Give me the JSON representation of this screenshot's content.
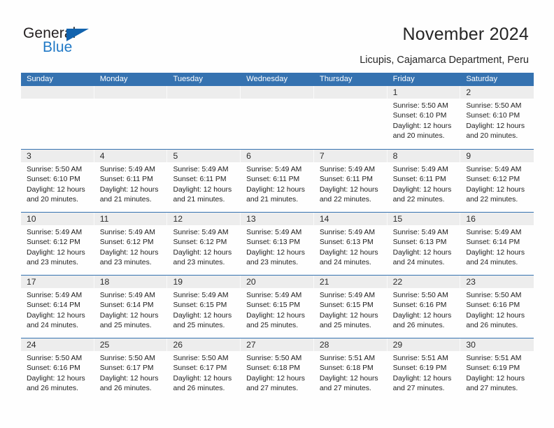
{
  "brand": {
    "name_part1": "General",
    "name_part2": "Blue",
    "triangle_color": "#1263ae",
    "blue_text_color": "#2079c6",
    "dark_text_color": "#231f20"
  },
  "header": {
    "title": "November 2024",
    "subtitle": "Licupis, Cajamarca Department, Peru",
    "accent_color": "#3572b0"
  },
  "calendar": {
    "weekdays": [
      "Sunday",
      "Monday",
      "Tuesday",
      "Wednesday",
      "Thursday",
      "Friday",
      "Saturday"
    ],
    "labels": {
      "sunrise": "Sunrise:",
      "sunset": "Sunset:",
      "daylight": "Daylight:"
    },
    "weeks": [
      [
        {
          "day": "",
          "sunrise": "",
          "sunset": "",
          "daylight_l1": "",
          "daylight_l2": ""
        },
        {
          "day": "",
          "sunrise": "",
          "sunset": "",
          "daylight_l1": "",
          "daylight_l2": ""
        },
        {
          "day": "",
          "sunrise": "",
          "sunset": "",
          "daylight_l1": "",
          "daylight_l2": ""
        },
        {
          "day": "",
          "sunrise": "",
          "sunset": "",
          "daylight_l1": "",
          "daylight_l2": ""
        },
        {
          "day": "",
          "sunrise": "",
          "sunset": "",
          "daylight_l1": "",
          "daylight_l2": ""
        },
        {
          "day": "1",
          "sunrise": "Sunrise: 5:50 AM",
          "sunset": "Sunset: 6:10 PM",
          "daylight_l1": "Daylight: 12 hours",
          "daylight_l2": "and 20 minutes."
        },
        {
          "day": "2",
          "sunrise": "Sunrise: 5:50 AM",
          "sunset": "Sunset: 6:10 PM",
          "daylight_l1": "Daylight: 12 hours",
          "daylight_l2": "and 20 minutes."
        }
      ],
      [
        {
          "day": "3",
          "sunrise": "Sunrise: 5:50 AM",
          "sunset": "Sunset: 6:10 PM",
          "daylight_l1": "Daylight: 12 hours",
          "daylight_l2": "and 20 minutes."
        },
        {
          "day": "4",
          "sunrise": "Sunrise: 5:49 AM",
          "sunset": "Sunset: 6:11 PM",
          "daylight_l1": "Daylight: 12 hours",
          "daylight_l2": "and 21 minutes."
        },
        {
          "day": "5",
          "sunrise": "Sunrise: 5:49 AM",
          "sunset": "Sunset: 6:11 PM",
          "daylight_l1": "Daylight: 12 hours",
          "daylight_l2": "and 21 minutes."
        },
        {
          "day": "6",
          "sunrise": "Sunrise: 5:49 AM",
          "sunset": "Sunset: 6:11 PM",
          "daylight_l1": "Daylight: 12 hours",
          "daylight_l2": "and 21 minutes."
        },
        {
          "day": "7",
          "sunrise": "Sunrise: 5:49 AM",
          "sunset": "Sunset: 6:11 PM",
          "daylight_l1": "Daylight: 12 hours",
          "daylight_l2": "and 22 minutes."
        },
        {
          "day": "8",
          "sunrise": "Sunrise: 5:49 AM",
          "sunset": "Sunset: 6:11 PM",
          "daylight_l1": "Daylight: 12 hours",
          "daylight_l2": "and 22 minutes."
        },
        {
          "day": "9",
          "sunrise": "Sunrise: 5:49 AM",
          "sunset": "Sunset: 6:12 PM",
          "daylight_l1": "Daylight: 12 hours",
          "daylight_l2": "and 22 minutes."
        }
      ],
      [
        {
          "day": "10",
          "sunrise": "Sunrise: 5:49 AM",
          "sunset": "Sunset: 6:12 PM",
          "daylight_l1": "Daylight: 12 hours",
          "daylight_l2": "and 23 minutes."
        },
        {
          "day": "11",
          "sunrise": "Sunrise: 5:49 AM",
          "sunset": "Sunset: 6:12 PM",
          "daylight_l1": "Daylight: 12 hours",
          "daylight_l2": "and 23 minutes."
        },
        {
          "day": "12",
          "sunrise": "Sunrise: 5:49 AM",
          "sunset": "Sunset: 6:12 PM",
          "daylight_l1": "Daylight: 12 hours",
          "daylight_l2": "and 23 minutes."
        },
        {
          "day": "13",
          "sunrise": "Sunrise: 5:49 AM",
          "sunset": "Sunset: 6:13 PM",
          "daylight_l1": "Daylight: 12 hours",
          "daylight_l2": "and 23 minutes."
        },
        {
          "day": "14",
          "sunrise": "Sunrise: 5:49 AM",
          "sunset": "Sunset: 6:13 PM",
          "daylight_l1": "Daylight: 12 hours",
          "daylight_l2": "and 24 minutes."
        },
        {
          "day": "15",
          "sunrise": "Sunrise: 5:49 AM",
          "sunset": "Sunset: 6:13 PM",
          "daylight_l1": "Daylight: 12 hours",
          "daylight_l2": "and 24 minutes."
        },
        {
          "day": "16",
          "sunrise": "Sunrise: 5:49 AM",
          "sunset": "Sunset: 6:14 PM",
          "daylight_l1": "Daylight: 12 hours",
          "daylight_l2": "and 24 minutes."
        }
      ],
      [
        {
          "day": "17",
          "sunrise": "Sunrise: 5:49 AM",
          "sunset": "Sunset: 6:14 PM",
          "daylight_l1": "Daylight: 12 hours",
          "daylight_l2": "and 24 minutes."
        },
        {
          "day": "18",
          "sunrise": "Sunrise: 5:49 AM",
          "sunset": "Sunset: 6:14 PM",
          "daylight_l1": "Daylight: 12 hours",
          "daylight_l2": "and 25 minutes."
        },
        {
          "day": "19",
          "sunrise": "Sunrise: 5:49 AM",
          "sunset": "Sunset: 6:15 PM",
          "daylight_l1": "Daylight: 12 hours",
          "daylight_l2": "and 25 minutes."
        },
        {
          "day": "20",
          "sunrise": "Sunrise: 5:49 AM",
          "sunset": "Sunset: 6:15 PM",
          "daylight_l1": "Daylight: 12 hours",
          "daylight_l2": "and 25 minutes."
        },
        {
          "day": "21",
          "sunrise": "Sunrise: 5:49 AM",
          "sunset": "Sunset: 6:15 PM",
          "daylight_l1": "Daylight: 12 hours",
          "daylight_l2": "and 25 minutes."
        },
        {
          "day": "22",
          "sunrise": "Sunrise: 5:50 AM",
          "sunset": "Sunset: 6:16 PM",
          "daylight_l1": "Daylight: 12 hours",
          "daylight_l2": "and 26 minutes."
        },
        {
          "day": "23",
          "sunrise": "Sunrise: 5:50 AM",
          "sunset": "Sunset: 6:16 PM",
          "daylight_l1": "Daylight: 12 hours",
          "daylight_l2": "and 26 minutes."
        }
      ],
      [
        {
          "day": "24",
          "sunrise": "Sunrise: 5:50 AM",
          "sunset": "Sunset: 6:16 PM",
          "daylight_l1": "Daylight: 12 hours",
          "daylight_l2": "and 26 minutes."
        },
        {
          "day": "25",
          "sunrise": "Sunrise: 5:50 AM",
          "sunset": "Sunset: 6:17 PM",
          "daylight_l1": "Daylight: 12 hours",
          "daylight_l2": "and 26 minutes."
        },
        {
          "day": "26",
          "sunrise": "Sunrise: 5:50 AM",
          "sunset": "Sunset: 6:17 PM",
          "daylight_l1": "Daylight: 12 hours",
          "daylight_l2": "and 26 minutes."
        },
        {
          "day": "27",
          "sunrise": "Sunrise: 5:50 AM",
          "sunset": "Sunset: 6:18 PM",
          "daylight_l1": "Daylight: 12 hours",
          "daylight_l2": "and 27 minutes."
        },
        {
          "day": "28",
          "sunrise": "Sunrise: 5:51 AM",
          "sunset": "Sunset: 6:18 PM",
          "daylight_l1": "Daylight: 12 hours",
          "daylight_l2": "and 27 minutes."
        },
        {
          "day": "29",
          "sunrise": "Sunrise: 5:51 AM",
          "sunset": "Sunset: 6:19 PM",
          "daylight_l1": "Daylight: 12 hours",
          "daylight_l2": "and 27 minutes."
        },
        {
          "day": "30",
          "sunrise": "Sunrise: 5:51 AM",
          "sunset": "Sunset: 6:19 PM",
          "daylight_l1": "Daylight: 12 hours",
          "daylight_l2": "and 27 minutes."
        }
      ]
    ]
  }
}
